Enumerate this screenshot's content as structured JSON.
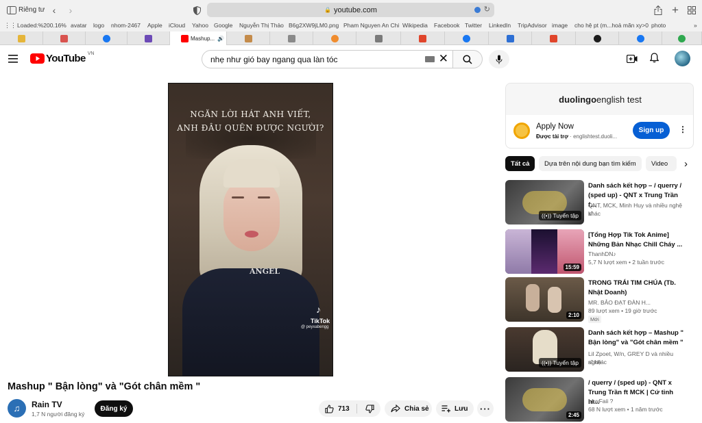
{
  "browser": {
    "profile_label": "Riêng tư",
    "url": "youtube.com",
    "bookmarks": [
      "Loaded:%200.16%",
      "avatar",
      "logo",
      "nhom-2467",
      "Apple",
      "iCloud",
      "Yahoo",
      "Google",
      "Nguyễn Thị Thảo",
      "B6g2XW9jLM0.png",
      "Pham Nguyen An Chi",
      "Wikipedia",
      "Facebook",
      "Twitter",
      "LinkedIn",
      "TripAdvisor",
      "image",
      "cho hệ pt (m...hoả mãn xy>0",
      "photo"
    ],
    "active_tab_label": "Mashup..."
  },
  "header": {
    "logo_text": "YouTube",
    "region": "VN",
    "search_query": "nhẹ như gió bay ngang qua làn tóc"
  },
  "video": {
    "lyric_line_1": "NGĂN LỜI HÁT ANH VIẾT,",
    "lyric_line_2": "ANH ĐÂU QUÊN ĐƯỢC NGƯỜI?",
    "watermark": "TikTok",
    "watermark_handle": "@ peyxabengg",
    "shirt_text": "ANGEL",
    "title": "Mashup \" Bận lòng\" và \"Gót chân mềm \"",
    "channel": "Rain TV",
    "subscribers": "1,7 N người đăng ký",
    "subscribe_label": "Đăng ký",
    "likes": "713",
    "share_label": "Chia sẻ",
    "save_label": "Lưu"
  },
  "ad": {
    "banner_brand": "duolingo",
    "banner_rest": " english test",
    "headline": "Apply Now",
    "sponsored": "Được tài trợ",
    "domain": "englishtest.duoli...",
    "cta": "Sign up"
  },
  "chips": [
    "Tất cả",
    "Dựa trên nội dung bạn tìm kiếm",
    "Video"
  ],
  "recommendations": [
    {
      "title": "Danh sách kết hợp – / querry / (sped up) - QNT x Trung Trần f...",
      "meta1": "QNT, MCK, Minh Huy và nhiều nghệ sĩ",
      "meta2": "khác",
      "tag": "Tuyển tập"
    },
    {
      "title": "[Tổng Hợp Tik Tok Anime] Những Bản Nhạc Chill Cháy ...",
      "meta1": "ThanhDN♪",
      "meta2": "5,7 N lượt xem  •  2 tuần trước",
      "duration": "15:59"
    },
    {
      "title": "TRONG TRÁI TIM CHÚA (Tb. Nhật Doanh)",
      "meta1": "MR. BẢO ĐẠT ĐÀN H...",
      "meta2": "89 lượt xem  •  19 giờ trước",
      "badge": "Mới",
      "duration": "2:10"
    },
    {
      "title": "Danh sách kết hợp – Mashup \" Bận lòng\" và \"Gót chân mềm \"",
      "meta1": "Lil Zpoet, W/n, GREY D và nhiều nghệ",
      "meta2": "sĩ khác",
      "tag": "Tuyển tập"
    },
    {
      "title": "/ querry / (sped up) - QNT x Trung Trần ft MCK | Cứ tỉnh hì...",
      "meta1": "LowFaii ?",
      "meta2": "68 N lượt xem  •  1 năm trước",
      "duration": "2:45"
    }
  ]
}
